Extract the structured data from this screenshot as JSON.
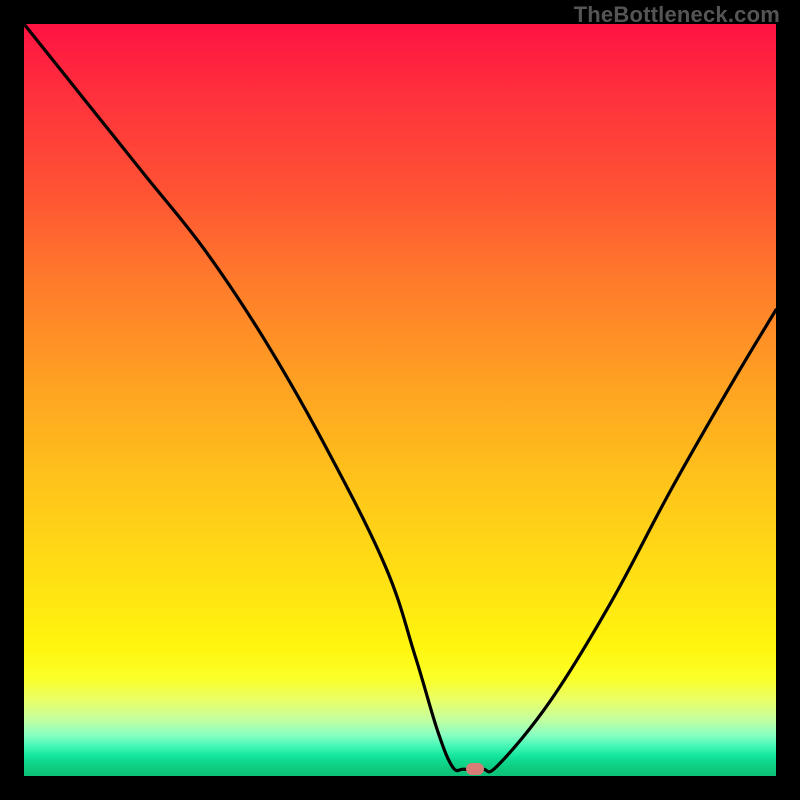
{
  "watermark": "TheBottleneck.com",
  "chart_data": {
    "type": "line",
    "title": "",
    "xlabel": "",
    "ylabel": "",
    "xlim": [
      0,
      100
    ],
    "ylim": [
      0,
      100
    ],
    "series": [
      {
        "name": "bottleneck-curve",
        "x": [
          0,
          8,
          16,
          24,
          32,
          40,
          48,
          52,
          55,
          57,
          58.5,
          61,
          63,
          70,
          78,
          86,
          94,
          100
        ],
        "y": [
          100,
          90,
          80,
          70,
          58,
          44,
          28,
          16,
          6,
          1.2,
          0.9,
          0.9,
          1.4,
          10,
          23,
          38,
          52,
          62
        ]
      }
    ],
    "marker": {
      "x": 60,
      "y": 0.9
    },
    "background_gradient": {
      "top": "#ff1343",
      "mid": "#ffe313",
      "bottom": "#0bc077"
    },
    "annotations": []
  }
}
